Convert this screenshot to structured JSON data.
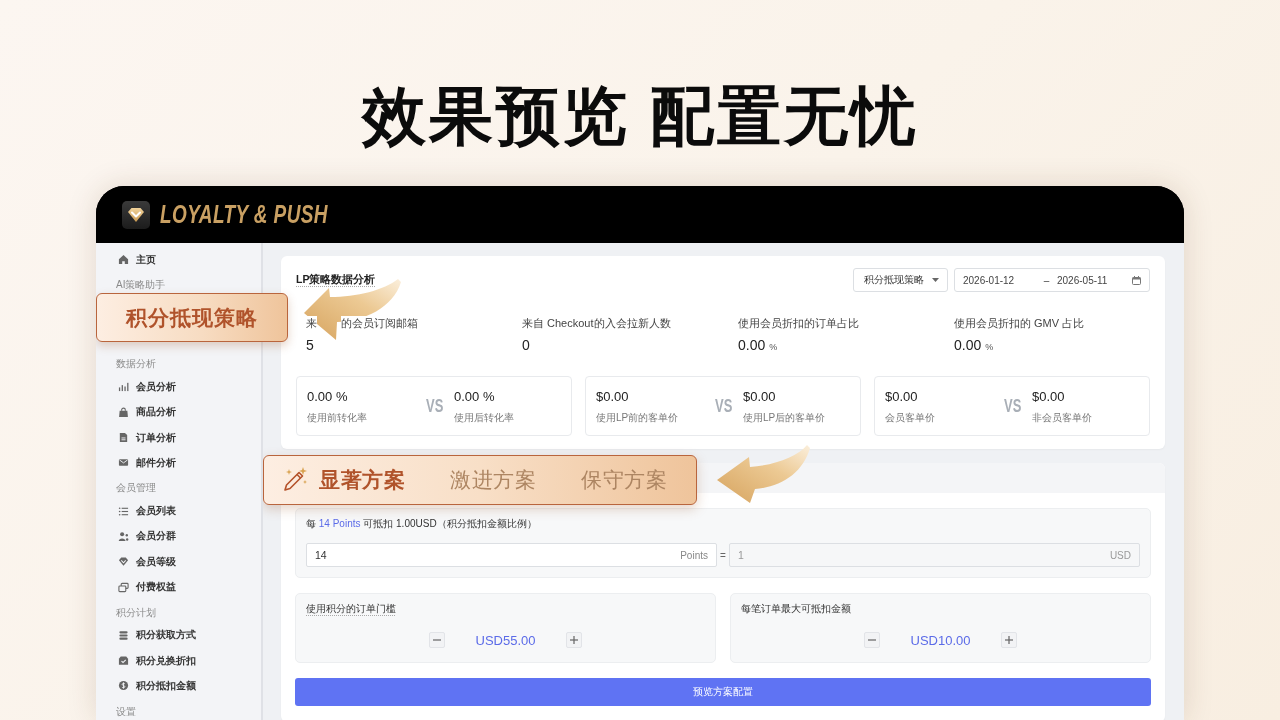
{
  "headline": "效果预览 配置无忧",
  "app_header": {
    "logo_text": "LOYALTY & PUSH"
  },
  "sidebar": {
    "items": [
      {
        "kind": "link",
        "label": "主页"
      },
      {
        "kind": "heading",
        "label": "AI策略助手"
      },
      {
        "kind": "callout",
        "label": "积分抵现策略"
      },
      {
        "kind": "heading",
        "label": "数据分析"
      },
      {
        "kind": "link",
        "label": "会员分析"
      },
      {
        "kind": "link",
        "label": "商品分析"
      },
      {
        "kind": "link",
        "label": "订单分析"
      },
      {
        "kind": "link",
        "label": "邮件分析"
      },
      {
        "kind": "heading",
        "label": "会员管理"
      },
      {
        "kind": "link",
        "label": "会员列表"
      },
      {
        "kind": "link",
        "label": "会员分群"
      },
      {
        "kind": "link",
        "label": "会员等级"
      },
      {
        "kind": "link",
        "label": "付费权益"
      },
      {
        "kind": "heading",
        "label": "积分计划"
      },
      {
        "kind": "link",
        "label": "积分获取方式"
      },
      {
        "kind": "link",
        "label": "积分兑换折扣"
      },
      {
        "kind": "link",
        "label": "积分抵扣金额"
      },
      {
        "kind": "heading",
        "label": "设置"
      }
    ]
  },
  "analytics": {
    "title": "LP策略数据分析",
    "strategy_select": {
      "value": "积分抵现策略"
    },
    "date_range": {
      "start": "2026-01-12",
      "separator": "–",
      "end": "2026-05-11"
    },
    "stats": [
      {
        "label_parts": [
          "来",
          "的会员订阅邮箱"
        ],
        "value": "5"
      },
      {
        "label_parts": [
          "来自 Checkout的入会拉新人数"
        ],
        "value": "0"
      },
      {
        "label_parts": [
          "使用会员折扣的订单占比"
        ],
        "value": "0.00",
        "unit": "%"
      },
      {
        "label_parts": [
          "使用会员折扣的 GMV 占比"
        ],
        "value": "0.00",
        "unit": "%"
      }
    ],
    "comparisons": [
      {
        "left": {
          "value": "0.00 %",
          "label": "使用前转化率"
        },
        "vs": "VS",
        "right": {
          "value": "0.00 %",
          "label": "使用后转化率"
        }
      },
      {
        "left": {
          "value": "$0.00",
          "label": "使用LP前的客单价"
        },
        "vs": "VS",
        "right": {
          "value": "$0.00",
          "label": "使用LP后的客单价"
        }
      },
      {
        "left": {
          "value": "$0.00",
          "label": "会员客单价"
        },
        "vs": "VS",
        "right": {
          "value": "$0.00",
          "label": "非会员客单价"
        }
      }
    ]
  },
  "plans": {
    "tabs": [
      {
        "label": "显著方案",
        "selected": true
      },
      {
        "label": "激进方案",
        "selected": false
      },
      {
        "label": "保守方案",
        "selected": false
      }
    ],
    "ratio": {
      "before": "每",
      "highlight": "14 Points",
      "after": "可抵扣 1.00USD（积分抵扣金额比例）"
    },
    "inputs": [
      {
        "value": "14",
        "suffix": "Points",
        "disabled": false
      },
      {
        "value": "1",
        "suffix": "USD",
        "disabled": true
      }
    ],
    "equals": "=",
    "limits": [
      {
        "label": "使用积分的订单门槛",
        "tooltip": true,
        "value": "USD55.00"
      },
      {
        "label": "每笔订单最大可抵扣金额",
        "tooltip": false,
        "value": "USD10.00"
      }
    ],
    "preview_button": "预览方案配置"
  }
}
